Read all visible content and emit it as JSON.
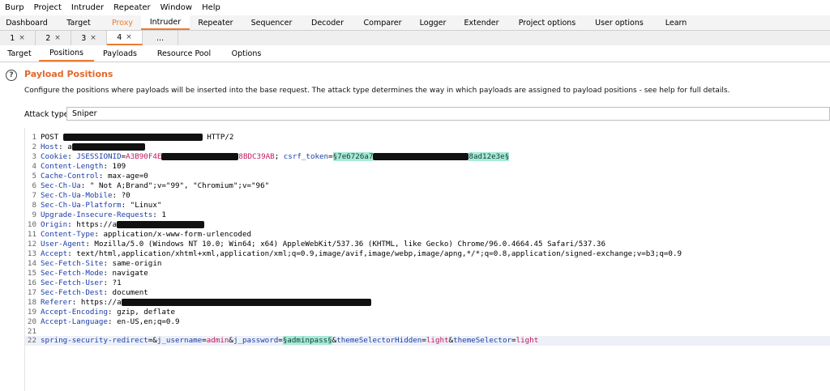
{
  "menu": [
    "Burp",
    "Project",
    "Intruder",
    "Repeater",
    "Window",
    "Help"
  ],
  "main_tabs": [
    "Dashboard",
    "Target",
    "Proxy",
    "Intruder",
    "Repeater",
    "Sequencer",
    "Decoder",
    "Comparer",
    "Logger",
    "Extender",
    "Project options",
    "User options",
    "Learn"
  ],
  "sub_tabs": [
    "1",
    "2",
    "3",
    "4",
    "..."
  ],
  "close_glyph": "×",
  "intruder_tabs": [
    "Target",
    "Positions",
    "Payloads",
    "Resource Pool",
    "Options"
  ],
  "payload_positions": {
    "help_glyph": "?",
    "title": "Payload Positions",
    "description": "Configure the positions where payloads will be inserted into the base request. The attack type determines the way in which payloads are assigned to payload positions - see help for full details.",
    "attack_type_label": "Attack type:",
    "attack_type_value": "Sniper"
  },
  "request": {
    "l1": {
      "n": "1",
      "method": "POST ",
      "version": "HTTP/2"
    },
    "l2": {
      "n": "2",
      "name": "Host",
      "value": "a"
    },
    "l3": {
      "n": "3",
      "name": "Cookie",
      "jsid_name": "JSESSIONID",
      "jsid_start": "A3B90F4E",
      "jsid_end": "8BDC39AB",
      "csrf_name": "csrf_token",
      "csrf_start": "§7e6726a7",
      "csrf_end": "8ad12e3e§"
    },
    "l4": {
      "n": "4",
      "name": "Content-Length",
      "value": "109"
    },
    "l5": {
      "n": "5",
      "name": "Cache-Control",
      "value": "max-age=0"
    },
    "l6": {
      "n": "6",
      "name": "Sec-Ch-Ua",
      "value": "\" Not A;Brand\";v=\"99\", \"Chromium\";v=\"96\""
    },
    "l7": {
      "n": "7",
      "name": "Sec-Ch-Ua-Mobile",
      "value": "?0"
    },
    "l8": {
      "n": "8",
      "name": "Sec-Ch-Ua-Platform",
      "value": "\"Linux\""
    },
    "l9": {
      "n": "9",
      "name": "Upgrade-Insecure-Requests",
      "value": "1"
    },
    "l10": {
      "n": "10",
      "name": "Origin",
      "value": "https://a"
    },
    "l11": {
      "n": "11",
      "name": "Content-Type",
      "value": "application/x-www-form-urlencoded"
    },
    "l12": {
      "n": "12",
      "name": "User-Agent",
      "value": "Mozilla/5.0 (Windows NT 10.0; Win64; x64) AppleWebKit/537.36 (KHTML, like Gecko) Chrome/96.0.4664.45 Safari/537.36"
    },
    "l13": {
      "n": "13",
      "name": "Accept",
      "value": "text/html,application/xhtml+xml,application/xml;q=0.9,image/avif,image/webp,image/apng,*/*;q=0.8,application/signed-exchange;v=b3;q=0.9"
    },
    "l14": {
      "n": "14",
      "name": "Sec-Fetch-Site",
      "value": "same-origin"
    },
    "l15": {
      "n": "15",
      "name": "Sec-Fetch-Mode",
      "value": "navigate"
    },
    "l16": {
      "n": "16",
      "name": "Sec-Fetch-User",
      "value": "?1"
    },
    "l17": {
      "n": "17",
      "name": "Sec-Fetch-Dest",
      "value": "document"
    },
    "l18": {
      "n": "18",
      "name": "Referer",
      "value": "https://a"
    },
    "l19": {
      "n": "19",
      "name": "Accept-Encoding",
      "value": "gzip, deflate"
    },
    "l20": {
      "n": "20",
      "name": "Accept-Language",
      "value": "en-US,en;q=0.9"
    },
    "l21": {
      "n": "21"
    },
    "l22": {
      "n": "22",
      "p1n": "spring-security-redirect",
      "p2n": "j_username",
      "p2v": "admin",
      "p3n": "j_password",
      "p3v": "§adminpass§",
      "p4n": "themeSelectorHidden",
      "p4v": "light",
      "p5n": "themeSelector",
      "p5v": "light"
    }
  },
  "colors": {
    "accent": "#f07a2d",
    "title": "#e2682a",
    "header_name": "#1a3ea8",
    "param_value": "#c2185b",
    "payload_bg": "#a8ead7"
  }
}
